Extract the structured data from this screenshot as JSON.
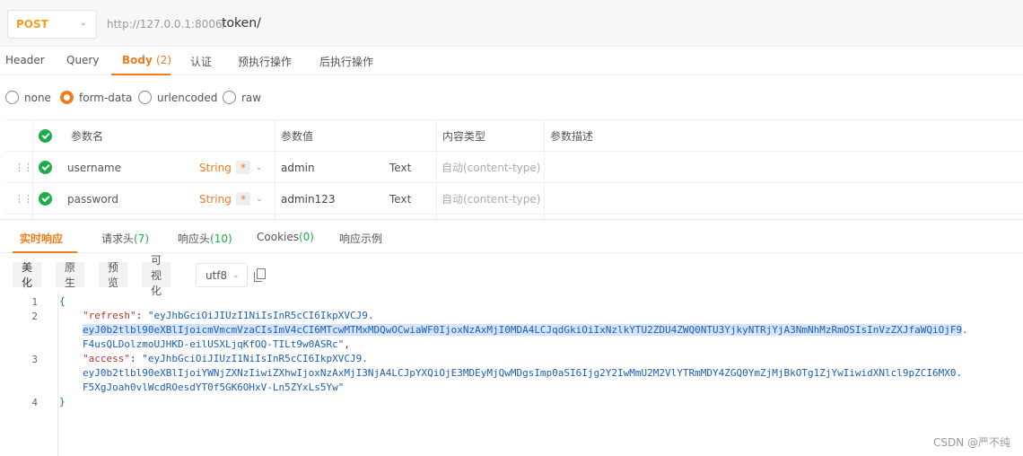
{
  "request": {
    "method": "POST",
    "base_url": "http://127.0.0.1:8006/",
    "path": "token/"
  },
  "tabs": [
    {
      "label": "Header"
    },
    {
      "label": "Query"
    },
    {
      "label": "Body",
      "count": "(2)"
    },
    {
      "label": "认证"
    },
    {
      "label": "预执行操作"
    },
    {
      "label": "后执行操作"
    }
  ],
  "body_types": [
    "none",
    "form-data",
    "urlencoded",
    "raw"
  ],
  "body_type_selected": "form-data",
  "params": {
    "headers": {
      "name": "参数名",
      "value": "参数值",
      "content_type": "内容类型",
      "desc": "参数描述"
    },
    "rows": [
      {
        "name": "username",
        "type": "String",
        "required": "*",
        "value": "admin",
        "value_type": "Text",
        "content_type": "自动(content-type)"
      },
      {
        "name": "password",
        "type": "String",
        "required": "*",
        "value": "admin123",
        "value_type": "Text",
        "content_type": "自动(content-type)"
      }
    ]
  },
  "response_tabs": [
    {
      "label": "实时响应"
    },
    {
      "label": "请求头",
      "count": "(7)"
    },
    {
      "label": "响应头",
      "count": "(10)"
    },
    {
      "label": "Cookies",
      "count": "(0)"
    },
    {
      "label": "响应示例"
    }
  ],
  "view_modes": [
    "美化",
    "原生",
    "预览",
    "可视化"
  ],
  "encoding": "utf8",
  "code": {
    "line_numbers": [
      "1",
      "2",
      "3",
      "4"
    ],
    "open_brace": "{",
    "close_brace": "}",
    "refresh_key": "\"refresh\"",
    "refresh_line1": "\"eyJhbGciOiJIUzI1NiIsInR5cCI6IkpXVCJ9.",
    "refresh_line2": "eyJ0b2tlbl90eXBlIjoicmVmcmVzaCIsImV4cCI6MTcwMTMxMDQwOCwiaWF0IjoxNzAxMjI0MDA4LCJqdGkiOiIxNzlkYTU2ZDU4ZWQ0NTU3YjkyNTRjYjA3NmNhMzRmOSIsInVzZXJfaWQiOjF9",
    "refresh_line2_tail": ".",
    "refresh_line3": "F4usQLDolzmoUJHKD-eilUSXLjqKfOQ-TILt9w0ASRc\"",
    "access_key": "\"access\"",
    "access_line1": "\"eyJhbGciOiJIUzI1NiIsInR5cCI6IkpXVCJ9.",
    "access_line2": "eyJ0b2tlbl90eXBlIjoiYWNjZXNzIiwiZXhwIjoxNzAxMjI3NjA4LCJpYXQiOjE3MDEyMjQwMDgsImp0aSI6Ijg2Y2IwMmU2M2VlYTRmMDY4ZGQ0YmZjMjBkOTg1ZjYwIiwidXNlcl9pZCI6MX0.",
    "access_line3": "F5XgJoah0vlWcdROesdYT0f5GK6OHxV-Ln5ZYxLs5Yw\""
  },
  "watermark": "CSDN @严不纯"
}
